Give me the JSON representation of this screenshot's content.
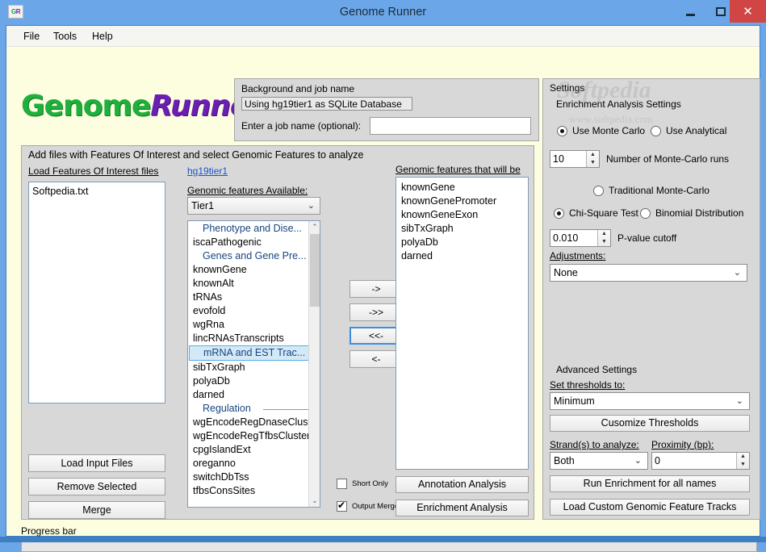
{
  "window": {
    "title": "Genome Runner",
    "icon_text_g": "G",
    "icon_text_r": "R",
    "minimize": "—",
    "maximize": "▢",
    "close": "✕",
    "titlebar_color": "#6ba7e8",
    "close_color": "#d14545"
  },
  "menu": {
    "file": "File",
    "tools": "Tools",
    "help": "Help"
  },
  "logo": {
    "part1": "Genome",
    "part2": "Runner",
    "color1": "#1faf3c",
    "color2": "#6a1fb0"
  },
  "job_group": {
    "title": "Background and job name",
    "database": "Using hg19tier1 as SQLite Database",
    "jobname_label": "Enter a job name (optional):",
    "jobname_value": "",
    "jobname_placeholder": ""
  },
  "main_group": {
    "title": "Add files with Features Of Interest and select Genomic Features to analyze",
    "load_foi_label": "Load Features Of Interest files",
    "db_link": "hg19tier1",
    "genomic_available_label": "Genomic features Available:",
    "genomic_run_label": "Genomic features that will be run:",
    "foi_files": [
      "Softpedia.txt"
    ],
    "tier_selected": "Tier1",
    "available_items": [
      {
        "label": "Phenotype and Dise...",
        "type": "header",
        "selected": false
      },
      {
        "label": "iscaPathogenic",
        "type": "item",
        "selected": false
      },
      {
        "label": "Genes and Gene Pre...",
        "type": "header",
        "selected": false
      },
      {
        "label": "knownGene",
        "type": "item",
        "selected": false
      },
      {
        "label": "knownAlt",
        "type": "item",
        "selected": false
      },
      {
        "label": "tRNAs",
        "type": "item",
        "selected": false
      },
      {
        "label": "evofold",
        "type": "item",
        "selected": false
      },
      {
        "label": "wgRna",
        "type": "item",
        "selected": false
      },
      {
        "label": "lincRNAsTranscripts",
        "type": "item",
        "selected": false
      },
      {
        "label": "mRNA and EST Trac...",
        "type": "header",
        "selected": true
      },
      {
        "label": "sibTxGraph",
        "type": "item",
        "selected": false
      },
      {
        "label": "polyaDb",
        "type": "item",
        "selected": false
      },
      {
        "label": "darned",
        "type": "item",
        "selected": false
      },
      {
        "label": "Regulation",
        "type": "header",
        "selected": false
      },
      {
        "label": "wgEncodeRegDnaseClustered",
        "type": "item",
        "selected": false
      },
      {
        "label": "wgEncodeRegTfbsClustered",
        "type": "item",
        "selected": false
      },
      {
        "label": "cpgIslandExt",
        "type": "item",
        "selected": false
      },
      {
        "label": "oreganno",
        "type": "item",
        "selected": false
      },
      {
        "label": "switchDbTss",
        "type": "item",
        "selected": false
      },
      {
        "label": "tfbsConsSites",
        "type": "item",
        "selected": false
      }
    ],
    "transfer_buttons": [
      {
        "label": "->",
        "focused": false
      },
      {
        "label": "->>",
        "focused": false
      },
      {
        "label": "<<-",
        "focused": true
      },
      {
        "label": "<-",
        "focused": false
      }
    ],
    "run_items": [
      "knownGene",
      "knownGenePromoter",
      "knownGeneExon",
      "sibTxGraph",
      "polyaDb",
      "darned"
    ],
    "left_buttons": [
      "Load Input Files",
      "Remove Selected",
      "Merge"
    ],
    "checkbox_short_only": {
      "label": "Short Only",
      "checked": false
    },
    "checkbox_output_merged": {
      "label": "Output Merged",
      "checked": true
    },
    "btn_annotation": "Annotation Analysis",
    "btn_enrichment": "Enrichment Analysis"
  },
  "settings": {
    "title": "Settings",
    "enrichment_title": "Enrichment Analysis Settings",
    "radio_monte_carlo": {
      "label": "Use Monte Carlo",
      "checked": true
    },
    "radio_analytical": {
      "label": "Use Analytical",
      "checked": false
    },
    "mc_runs_value": "10",
    "mc_runs_label": "Number of Monte-Carlo runs",
    "radio_traditional": {
      "label": "Traditional Monte-Carlo",
      "checked": false
    },
    "radio_chisquare": {
      "label": "Chi-Square Test",
      "checked": true
    },
    "radio_binomial": {
      "label": "Binomial Distribution",
      "checked": false
    },
    "pvalue_value": "0.010",
    "pvalue_label": "P-value cutoff",
    "adjustments_label": "Adjustments:",
    "adjustments_value": "None",
    "advanced_title": "Advanced Settings",
    "thresholds_label": "Set thresholds to:",
    "thresholds_value": "Minimum",
    "btn_customize": "Cusomize Thresholds",
    "strand_label": "Strand(s) to analyze:",
    "strand_value": "Both",
    "proximity_label": "Proximity (bp):",
    "proximity_value": "0",
    "btn_run_enrichment": "Run Enrichment for all names",
    "btn_load_tracks": "Load Custom Genomic Feature Tracks"
  },
  "progress": {
    "label": "Progress bar",
    "value": 0
  },
  "watermark": {
    "line1": "Softpedia",
    "line2": "www.softpedia.com"
  },
  "icons": {
    "chevron_down": "⌄",
    "chevron_up": "⌃",
    "spin_up": "▲",
    "spin_down": "▼"
  }
}
